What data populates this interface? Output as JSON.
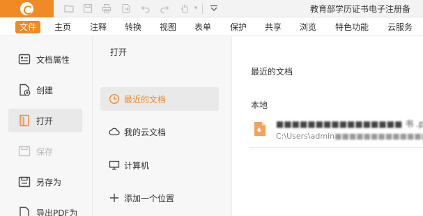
{
  "window": {
    "title": "教育部学历证书电子注册备",
    "quick_access_icons": [
      "open-folder-icon",
      "save-icon",
      "print-icon",
      "export-icon",
      "undo-icon",
      "redo-icon",
      "hand-tool-icon",
      "chevron-down-icon",
      "customize-icon"
    ]
  },
  "menu": {
    "items": [
      {
        "label": "文件",
        "active": true
      },
      {
        "label": "主页"
      },
      {
        "label": "注释"
      },
      {
        "label": "转换"
      },
      {
        "label": "视图"
      },
      {
        "label": "表单"
      },
      {
        "label": "保护"
      },
      {
        "label": "共享"
      },
      {
        "label": "浏览"
      },
      {
        "label": "特色功能"
      },
      {
        "label": "云服务"
      }
    ]
  },
  "left_panel": {
    "items": [
      {
        "label": "文档属性",
        "icon": "document-properties-icon"
      },
      {
        "label": "创建",
        "icon": "create-icon"
      },
      {
        "label": "打开",
        "icon": "open-icon",
        "active": true
      },
      {
        "label": "保存",
        "icon": "save-icon",
        "disabled": true
      },
      {
        "label": "另存为",
        "icon": "save-as-icon"
      },
      {
        "label": "导出PDF为",
        "icon": "export-pdf-icon"
      }
    ]
  },
  "middle_panel": {
    "title": "打开",
    "items": [
      {
        "label": "最近的文档",
        "icon": "clock-icon",
        "active": true
      },
      {
        "label": "我的云文档",
        "icon": "cloud-icon"
      },
      {
        "label": "计算机",
        "icon": "computer-icon"
      },
      {
        "label": "添加一个位置",
        "icon": "plus-icon"
      }
    ]
  },
  "main": {
    "title": "最近的文档",
    "section": "本地",
    "files": [
      {
        "name": "■■■■■■■■■■■■■■■■ 书 .pdf",
        "path_prefix": "C:\\Users\\admin",
        "path_rest": "■■■■■■■■■■■■■■■■证书.pdf"
      }
    ]
  },
  "colors": {
    "accent": "#f08a24",
    "panel_bg": "#f7f7f7",
    "active_bg": "#e9e9e9"
  }
}
